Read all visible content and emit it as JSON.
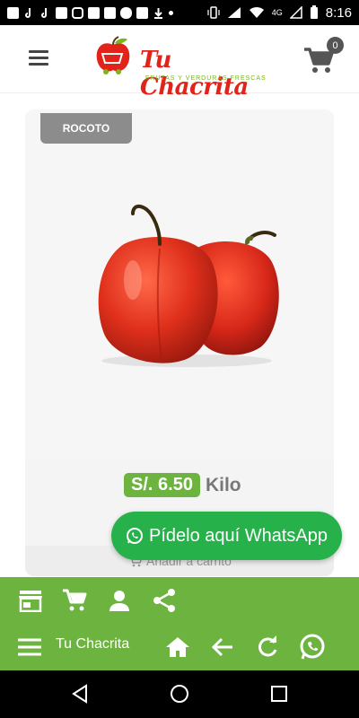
{
  "status_bar": {
    "time": "8:16",
    "network": "4G",
    "icons": [
      "facebook-icon",
      "tiktok-icon",
      "tiktok-icon",
      "camera-icon",
      "instagram-icon",
      "mail-icon",
      "vk-icon",
      "cloud-icon",
      "photo-icon",
      "download-icon",
      "dot-icon"
    ]
  },
  "header": {
    "logo_name": "Tu Chacrita",
    "logo_tagline": "FRUTAS Y VERDURAS FRESCAS",
    "cart_count": "0"
  },
  "product": {
    "name": "ROCOTO",
    "price": "S/. 6.50",
    "unit": "Kilo",
    "add_to_cart": "Añadir a carrito"
  },
  "whatsapp": {
    "label": "Pídelo aquí WhatsApp"
  },
  "bottom_bar": {
    "app_title": "Tu Chacrita",
    "row1_icons": [
      "store-icon",
      "cart-icon",
      "person-icon",
      "share-icon"
    ],
    "row2_icons": [
      "menu-icon",
      "home-icon",
      "back-arrow-icon",
      "refresh-icon",
      "whatsapp-icon"
    ]
  },
  "nav_bar": {
    "buttons": [
      "back-icon",
      "home-circle-icon",
      "recents-icon"
    ]
  },
  "colors": {
    "brand_green": "#6cb33f",
    "whatsapp_green": "#27b14a",
    "brand_red": "#e2231a"
  }
}
